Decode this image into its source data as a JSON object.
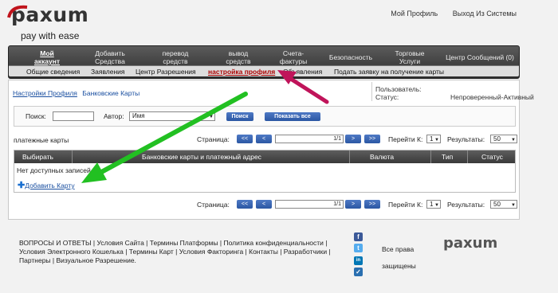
{
  "brand": {
    "logo": "paxum",
    "tagline": "pay with ease"
  },
  "top_links": {
    "profile": "Мой Профиль",
    "logout": "Выход Из Системы"
  },
  "nav": {
    "items": [
      "Мой аккаунт",
      "Добавить Средства",
      "перевод средств",
      "вывод средств",
      "Счета-фактуры",
      "Безопасность",
      "Торговые Услуги",
      "Центр Сообщений (0)"
    ],
    "sub_items": [
      "Общие сведения",
      "Заявления",
      "Центр Разрешения",
      "настройка профиля",
      "Объявления",
      "Подать заявку на получение карты"
    ]
  },
  "breadcrumb": {
    "parent": "Настройки Профиля",
    "current": "Банковские Карты"
  },
  "user_info": {
    "user_label": "Пользователь:",
    "user_value": "",
    "status_label": "Статус:",
    "status_value": "Непроверенный-Активный"
  },
  "search": {
    "search_label": "Поиск:",
    "author_label": "Автор:",
    "author_value": "Имя",
    "search_btn": "Поиск",
    "show_all_btn": "Показать все"
  },
  "section_title": "платежные карты",
  "pager": {
    "page_label": "Страница:",
    "first": "<<",
    "prev": "<",
    "next": ">",
    "last": ">>",
    "page_value": "1/1",
    "goto_label": "Перейти К:",
    "goto_value": "1",
    "results_label": "Результаты:",
    "results_value": "50"
  },
  "table": {
    "columns": [
      "Выбирать",
      "Банковские карты и платежный адрес",
      "Валюта",
      "Тип",
      "Статус"
    ],
    "empty": "Нет доступных записей",
    "add_card": "Добавить Карту"
  },
  "footer": {
    "links": "ВОПРОСЫ И ОТВЕТЫ | Условия Сайта | Термины Платформы | Политика конфиденциальности | Условия Электронного Кошелька | Термины Карт | Условия Факторинга | Контакты | Разработчики | Партнеры | Визуальное Разрешение.",
    "rights_1": "Все права",
    "rights_2": "защищены",
    "logo": "paxum",
    "social": [
      "f",
      "t",
      "in",
      "✓"
    ]
  },
  "colors": {
    "arrow_green": "#22c022",
    "arrow_magenta": "#c0145a",
    "nav_dark": "#3a3a3a",
    "button_blue": "#2b57a3"
  }
}
